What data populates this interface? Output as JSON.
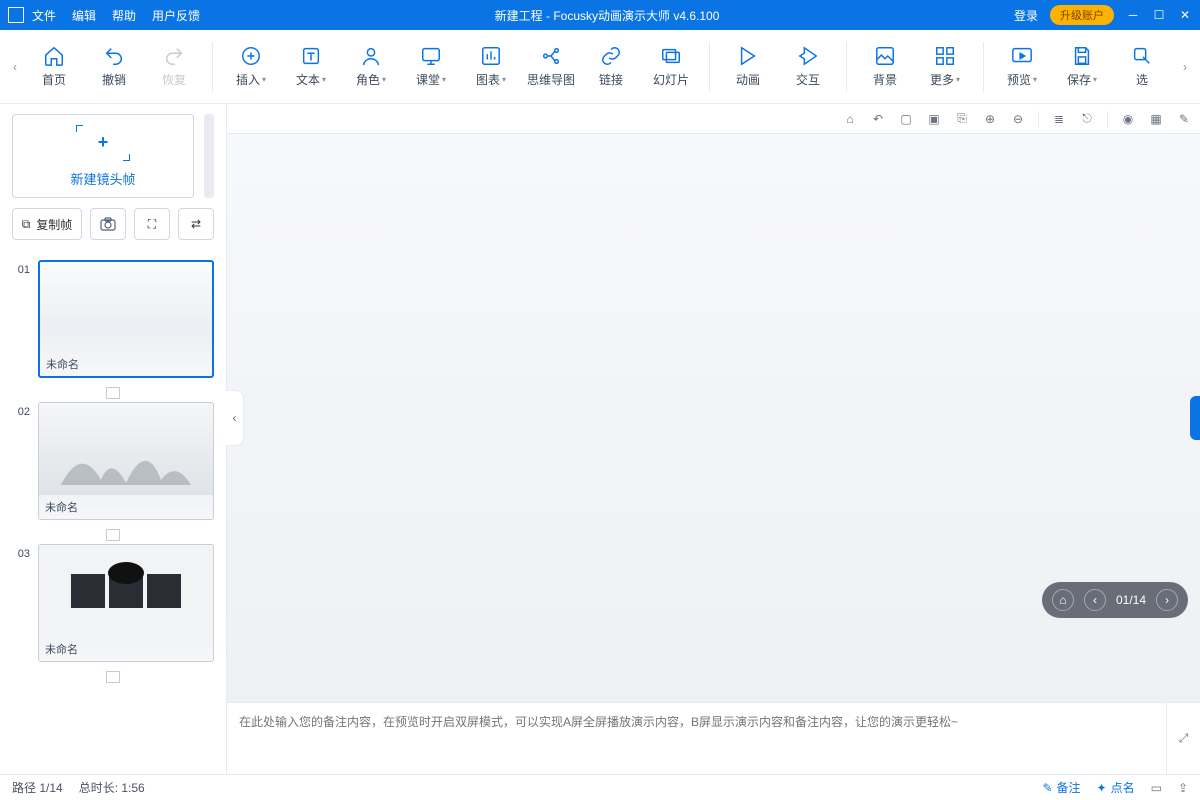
{
  "titlebar": {
    "menus": [
      "文件",
      "编辑",
      "帮助",
      "用户反馈"
    ],
    "title": "新建工程 - Focusky动画演示大师  v4.6.100",
    "login": "登录",
    "upgrade": "升级账户"
  },
  "toolbar": {
    "items": [
      {
        "icon": "home",
        "label": "首页"
      },
      {
        "icon": "undo",
        "label": "撤销"
      },
      {
        "icon": "redo",
        "label": "恢复",
        "dim": true
      },
      {
        "sep": true
      },
      {
        "icon": "plus-circle",
        "label": "插入",
        "caret": true
      },
      {
        "icon": "text",
        "label": "文本",
        "caret": true
      },
      {
        "icon": "person",
        "label": "角色",
        "caret": true
      },
      {
        "icon": "class",
        "label": "课堂",
        "caret": true
      },
      {
        "icon": "chart",
        "label": "图表",
        "caret": true
      },
      {
        "icon": "mind",
        "label": "思维导图"
      },
      {
        "icon": "link",
        "label": "链接"
      },
      {
        "icon": "slide",
        "label": "幻灯片"
      },
      {
        "sep": true
      },
      {
        "icon": "anim",
        "label": "动画"
      },
      {
        "icon": "interact",
        "label": "交互"
      },
      {
        "sep": true
      },
      {
        "icon": "bg",
        "label": "背景"
      },
      {
        "icon": "more",
        "label": "更多",
        "caret": true
      },
      {
        "sep": true
      },
      {
        "icon": "preview",
        "label": "预览",
        "caret": true
      },
      {
        "icon": "save",
        "label": "保存",
        "caret": true
      },
      {
        "icon": "select",
        "label": "选"
      }
    ]
  },
  "sidebar": {
    "newframe": "新建镜头帧",
    "copyframe": "复制帧",
    "slides": [
      {
        "num": "01",
        "caption": "未命名",
        "active": true,
        "kind": "blank"
      },
      {
        "num": "02",
        "caption": "未命名",
        "active": false,
        "kind": "ink"
      },
      {
        "num": "03",
        "caption": "未命名",
        "active": false,
        "kind": "toc"
      }
    ]
  },
  "canvasbar_icons": [
    "home",
    "back",
    "box1",
    "box2",
    "paste",
    "zoomin",
    "zoomout",
    "|",
    "align",
    "lock",
    "|",
    "camera",
    "grid",
    "edit"
  ],
  "pager": {
    "text": "01/14"
  },
  "notes": {
    "placeholder": "在此处输入您的备注内容，在预览时开启双屏模式，可以实现A屏全屏播放演示内容，B屏显示演示内容和备注内容，让您的演示更轻松~"
  },
  "status": {
    "path_label": "路径 1/14",
    "duration_label": "总时长: 1:56",
    "remark": "备注",
    "like": "点名"
  }
}
